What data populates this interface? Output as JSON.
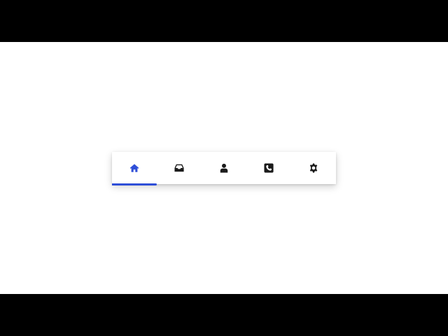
{
  "tabbar": {
    "active_index": 0,
    "active_color": "#2f4fd8",
    "inactive_color": "#1b1b1b",
    "tabs": [
      {
        "icon": "home-icon"
      },
      {
        "icon": "inbox-icon"
      },
      {
        "icon": "user-icon"
      },
      {
        "icon": "phone-icon"
      },
      {
        "icon": "gear-icon"
      }
    ]
  }
}
